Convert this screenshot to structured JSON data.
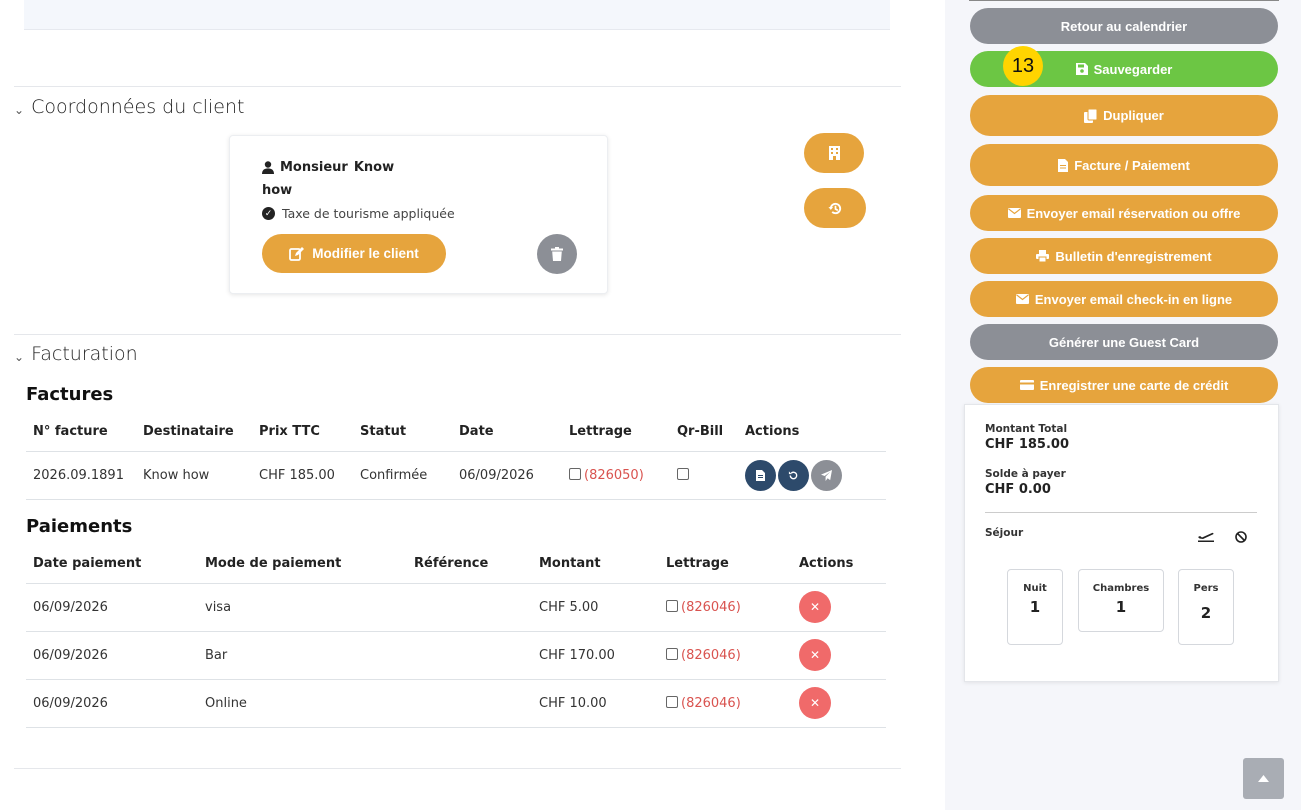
{
  "client_section": {
    "title": "Coordonnées du client",
    "civility": "Monsieur",
    "first_name": "Know",
    "last_name": "how",
    "tax_label": "Taxe de tourisme appliquée",
    "edit_label": "Modifier le client"
  },
  "billing_section": {
    "title": "Facturation",
    "invoices_title": "Factures",
    "invoice_headers": [
      "N° facture",
      "Destinataire",
      "Prix TTC",
      "Statut",
      "Date",
      "Lettrage",
      "Qr-Bill",
      "Actions"
    ],
    "invoices": [
      {
        "number": "2026.09.1891",
        "recipient": "Know how",
        "price": "CHF 185.00",
        "status": "Confirmée",
        "date": "06/09/2026",
        "lettering": "(826050)"
      }
    ],
    "payments_title": "Paiements",
    "payment_headers": [
      "Date paiement",
      "Mode de paiement",
      "Référence",
      "Montant",
      "Lettrage",
      "Actions"
    ],
    "payments": [
      {
        "date": "06/09/2026",
        "mode": "visa",
        "reference": "",
        "amount": "CHF 5.00",
        "lettering": "(826046)"
      },
      {
        "date": "06/09/2026",
        "mode": "Bar",
        "reference": "",
        "amount": "CHF 170.00",
        "lettering": "(826046)"
      },
      {
        "date": "06/09/2026",
        "mode": "Online",
        "reference": "",
        "amount": "CHF 10.00",
        "lettering": "(826046)"
      }
    ]
  },
  "sidebar": {
    "badge": "13",
    "buttons": {
      "back": "Retour au calendrier",
      "save": "Sauvegarder",
      "duplicate": "Dupliquer",
      "invoice": "Facture / Paiement",
      "email_booking": "Envoyer email réservation ou offre",
      "registration": "Bulletin d'enregistrement",
      "email_checkin": "Envoyer email check-in en ligne",
      "guest_card": "Générer une Guest Card",
      "credit_card": "Enregistrer une carte de crédit"
    },
    "summary": {
      "total_label": "Montant Total",
      "total_value": "CHF 185.00",
      "balance_label": "Solde à payer",
      "balance_value": "CHF 0.00",
      "stay_label": "Séjour",
      "nights_label": "Nuit",
      "nights_value": "1",
      "rooms_label": "Chambres",
      "rooms_value": "1",
      "persons_label": "Pers",
      "persons_value": "2"
    }
  },
  "colors": {
    "accent_orange": "#e6a43d",
    "save_green": "#6cc644",
    "neutral_grey": "#8c8f96",
    "action_navy": "#2d4a6b",
    "delete_red": "#f06a6a",
    "lettering_red": "#d9534f",
    "badge_yellow": "#ffd400"
  },
  "icons": {
    "client": "user-icon",
    "tax": "check-circle-icon",
    "edit": "edit-icon",
    "delete": "trash-icon",
    "company": "building-icon",
    "history": "history-icon",
    "save": "floppy-disk-icon",
    "duplicate": "copy-icon",
    "invoice": "file-icon",
    "email": "envelope-icon",
    "print": "printer-icon",
    "credit_card": "credit-card-icon",
    "departure": "plane-departure-icon",
    "cancel": "ban-icon",
    "scroll_top": "chevron-up-icon"
  }
}
